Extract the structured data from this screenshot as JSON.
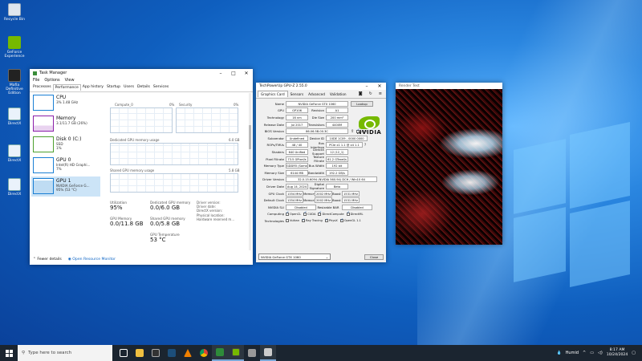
{
  "desktop": {
    "icons": [
      {
        "label": "Recycle Bin"
      },
      {
        "label": "GeForce Experience"
      },
      {
        "label": "Mafia Definitive Edition"
      },
      {
        "label": "DirectX"
      },
      {
        "label": "DirectX"
      },
      {
        "label": "DirectX"
      }
    ]
  },
  "taskmanager": {
    "title": "Task Manager",
    "menu": [
      "File",
      "Options",
      "View"
    ],
    "tabs": [
      "Processes",
      "Performance",
      "App history",
      "Startup",
      "Users",
      "Details",
      "Services"
    ],
    "resources": [
      {
        "name": "CPU",
        "sub1": "3% 1.48 GHz",
        "sub2": "",
        "color": "#1a7fd4"
      },
      {
        "name": "Memory",
        "sub1": "3.1/11.7 GB (26%)",
        "sub2": "",
        "color": "#8b1fa9"
      },
      {
        "name": "Disk 0 (C:)",
        "sub1": "SSD",
        "sub2": "1%",
        "color": "#4da02e"
      },
      {
        "name": "GPU 0",
        "sub1": "Intel(R) HD Graphi...",
        "sub2": "7%",
        "color": "#1a7fd4"
      },
      {
        "name": "GPU 1",
        "sub1": "NVIDIA GeForce G...",
        "sub2": "95% (53 °C)",
        "color": "#1a7fd4"
      }
    ],
    "graphs": {
      "g1_label": "Compute_0",
      "g1_pct": "0%",
      "g2_label": "Security",
      "g2_pct": "0%",
      "dedicated_label": "Dedicated GPU memory usage",
      "dedicated_max": "6.0 GB",
      "shared_label": "Shared GPU memory usage",
      "shared_max": "5.8 GB"
    },
    "stats": {
      "utilization_k": "Utilization",
      "utilization_v": "95%",
      "dedicated_k": "Dedicated GPU memory",
      "dedicated_v": "0.0/6.0 GB",
      "gpumem_k": "GPU Memory",
      "gpumem_v": "0.0/11.8 GB",
      "shared_k": "Shared GPU memory",
      "shared_v": "0.0/5.8 GB",
      "temp_k": "GPU Temperature",
      "temp_v": "53 °C",
      "info1": "Driver version:",
      "info2": "Driver date:",
      "info3": "DirectX version:",
      "info4": "Physical location:",
      "info5": "Hardware reserved m..."
    },
    "footer": {
      "fewer": "Fewer details",
      "monitor": "Open Resource Monitor"
    }
  },
  "gpuz": {
    "title": "TechPowerUp GPU-Z 2.55.0",
    "tabs": [
      "Graphics Card",
      "Sensors",
      "Advanced",
      "Validation"
    ],
    "lookup": "Lookup",
    "name": "NVIDIA GeForce GTX 1060",
    "gpu": "GP106",
    "revision": "A1",
    "technology": "16 nm",
    "die_size": "200 mm²",
    "release_date": "Jul 2017",
    "transistors": "4400M",
    "bios": "86.06.5B.00.3C",
    "uefi": "UEFI",
    "subvendor": "Undefined",
    "device_id": "10DE 1C09 - 0000 0000",
    "rops": "48 / 40",
    "bus_interface": "PCIe x1 1.1 @ x4 1.1",
    "shaders": "640 Unified",
    "directx": "12 (12_1)",
    "pixel_fillrate": "73.5 GPixel/s",
    "texture_fillrate": "61.2 GTexel/s",
    "memory_type": "GDDR5 (Samsung)",
    "bus_width": "192 bit",
    "memory_size": "6144 MB",
    "bandwidth": "192.2 GB/s",
    "driver_version": "32.0.15.6094 (NVIDIA 560.94) DCH / Win10 64",
    "driver_date": "Aug 14, 2024",
    "digital_signature": "Beta",
    "gpu_clock": "1354 MHz",
    "memory_clock": "2002 MHz",
    "boost": "1531 MHz",
    "default_clock": "1354 MHz",
    "default_memory": "2002 MHz",
    "default_boost": "1531 MHz",
    "sli": "Disabled",
    "resizable_bar": "Resizable BAR",
    "rbar_val": "Disabled",
    "labels": {
      "name": "Name",
      "gpu": "GPU",
      "revision": "Revision",
      "technology": "Technology",
      "die_size": "Die Size",
      "release_date": "Release Date",
      "transistors": "Transistors",
      "bios": "BIOS Version",
      "subvendor": "Subvendor",
      "device_id": "Device ID",
      "rops": "ROPs/TMUs",
      "bus_interface": "Bus Interface",
      "shaders": "Shaders",
      "directx": "DirectX Support",
      "pixel": "Pixel Fillrate",
      "texture": "Texture Fillrate",
      "memtype": "Memory Type",
      "buswidth": "Bus Width",
      "memsize": "Memory Size",
      "bandwidth": "Bandwidth",
      "driver": "Driver Version",
      "driver_date": "Driver Date",
      "digsig": "Digital Signature",
      "gpu_clock": "GPU Clock",
      "memory": "Memory",
      "boost": "Boost",
      "default_clock": "Default Clock",
      "sli": "NVIDIA SLI",
      "computing": "Computing",
      "technologies": "Technologies"
    },
    "computing": [
      "OpenCL",
      "CUDA",
      "DirectCompute",
      "DirectML"
    ],
    "technologies": [
      "Vulkan",
      "Ray Tracing",
      "PhysX",
      "OpenGL 1.1"
    ],
    "selected_card": "NVIDIA GeForce GTX 1060",
    "close": "Close"
  },
  "render": {
    "title": "Render Test"
  },
  "taskbar": {
    "search_placeholder": "Type here to search",
    "weather": "Humid",
    "time": "8:17 AM",
    "date": "10/24/2024"
  }
}
